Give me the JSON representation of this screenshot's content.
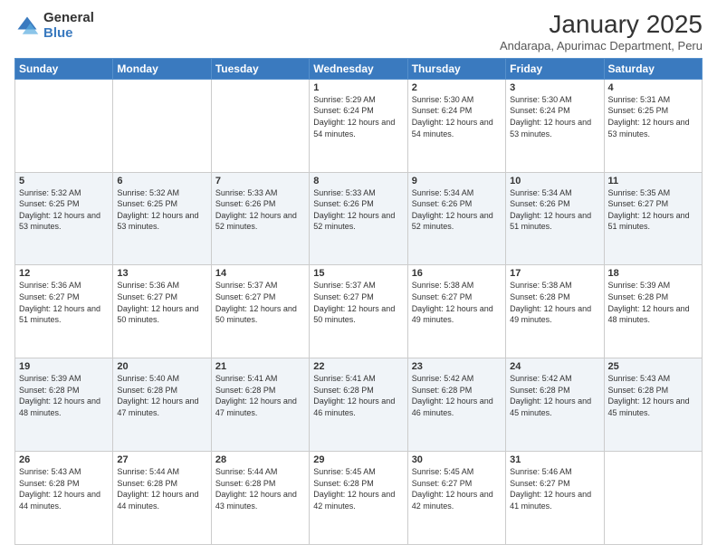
{
  "logo": {
    "general": "General",
    "blue": "Blue"
  },
  "header": {
    "title": "January 2025",
    "subtitle": "Andarapa, Apurimac Department, Peru"
  },
  "days_of_week": [
    "Sunday",
    "Monday",
    "Tuesday",
    "Wednesday",
    "Thursday",
    "Friday",
    "Saturday"
  ],
  "weeks": [
    [
      {
        "day": "",
        "info": ""
      },
      {
        "day": "",
        "info": ""
      },
      {
        "day": "",
        "info": ""
      },
      {
        "day": "1",
        "info": "Sunrise: 5:29 AM\nSunset: 6:24 PM\nDaylight: 12 hours and 54 minutes."
      },
      {
        "day": "2",
        "info": "Sunrise: 5:30 AM\nSunset: 6:24 PM\nDaylight: 12 hours and 54 minutes."
      },
      {
        "day": "3",
        "info": "Sunrise: 5:30 AM\nSunset: 6:24 PM\nDaylight: 12 hours and 53 minutes."
      },
      {
        "day": "4",
        "info": "Sunrise: 5:31 AM\nSunset: 6:25 PM\nDaylight: 12 hours and 53 minutes."
      }
    ],
    [
      {
        "day": "5",
        "info": "Sunrise: 5:32 AM\nSunset: 6:25 PM\nDaylight: 12 hours and 53 minutes."
      },
      {
        "day": "6",
        "info": "Sunrise: 5:32 AM\nSunset: 6:25 PM\nDaylight: 12 hours and 53 minutes."
      },
      {
        "day": "7",
        "info": "Sunrise: 5:33 AM\nSunset: 6:26 PM\nDaylight: 12 hours and 52 minutes."
      },
      {
        "day": "8",
        "info": "Sunrise: 5:33 AM\nSunset: 6:26 PM\nDaylight: 12 hours and 52 minutes."
      },
      {
        "day": "9",
        "info": "Sunrise: 5:34 AM\nSunset: 6:26 PM\nDaylight: 12 hours and 52 minutes."
      },
      {
        "day": "10",
        "info": "Sunrise: 5:34 AM\nSunset: 6:26 PM\nDaylight: 12 hours and 51 minutes."
      },
      {
        "day": "11",
        "info": "Sunrise: 5:35 AM\nSunset: 6:27 PM\nDaylight: 12 hours and 51 minutes."
      }
    ],
    [
      {
        "day": "12",
        "info": "Sunrise: 5:36 AM\nSunset: 6:27 PM\nDaylight: 12 hours and 51 minutes."
      },
      {
        "day": "13",
        "info": "Sunrise: 5:36 AM\nSunset: 6:27 PM\nDaylight: 12 hours and 50 minutes."
      },
      {
        "day": "14",
        "info": "Sunrise: 5:37 AM\nSunset: 6:27 PM\nDaylight: 12 hours and 50 minutes."
      },
      {
        "day": "15",
        "info": "Sunrise: 5:37 AM\nSunset: 6:27 PM\nDaylight: 12 hours and 50 minutes."
      },
      {
        "day": "16",
        "info": "Sunrise: 5:38 AM\nSunset: 6:27 PM\nDaylight: 12 hours and 49 minutes."
      },
      {
        "day": "17",
        "info": "Sunrise: 5:38 AM\nSunset: 6:28 PM\nDaylight: 12 hours and 49 minutes."
      },
      {
        "day": "18",
        "info": "Sunrise: 5:39 AM\nSunset: 6:28 PM\nDaylight: 12 hours and 48 minutes."
      }
    ],
    [
      {
        "day": "19",
        "info": "Sunrise: 5:39 AM\nSunset: 6:28 PM\nDaylight: 12 hours and 48 minutes."
      },
      {
        "day": "20",
        "info": "Sunrise: 5:40 AM\nSunset: 6:28 PM\nDaylight: 12 hours and 47 minutes."
      },
      {
        "day": "21",
        "info": "Sunrise: 5:41 AM\nSunset: 6:28 PM\nDaylight: 12 hours and 47 minutes."
      },
      {
        "day": "22",
        "info": "Sunrise: 5:41 AM\nSunset: 6:28 PM\nDaylight: 12 hours and 46 minutes."
      },
      {
        "day": "23",
        "info": "Sunrise: 5:42 AM\nSunset: 6:28 PM\nDaylight: 12 hours and 46 minutes."
      },
      {
        "day": "24",
        "info": "Sunrise: 5:42 AM\nSunset: 6:28 PM\nDaylight: 12 hours and 45 minutes."
      },
      {
        "day": "25",
        "info": "Sunrise: 5:43 AM\nSunset: 6:28 PM\nDaylight: 12 hours and 45 minutes."
      }
    ],
    [
      {
        "day": "26",
        "info": "Sunrise: 5:43 AM\nSunset: 6:28 PM\nDaylight: 12 hours and 44 minutes."
      },
      {
        "day": "27",
        "info": "Sunrise: 5:44 AM\nSunset: 6:28 PM\nDaylight: 12 hours and 44 minutes."
      },
      {
        "day": "28",
        "info": "Sunrise: 5:44 AM\nSunset: 6:28 PM\nDaylight: 12 hours and 43 minutes."
      },
      {
        "day": "29",
        "info": "Sunrise: 5:45 AM\nSunset: 6:28 PM\nDaylight: 12 hours and 42 minutes."
      },
      {
        "day": "30",
        "info": "Sunrise: 5:45 AM\nSunset: 6:27 PM\nDaylight: 12 hours and 42 minutes."
      },
      {
        "day": "31",
        "info": "Sunrise: 5:46 AM\nSunset: 6:27 PM\nDaylight: 12 hours and 41 minutes."
      },
      {
        "day": "",
        "info": ""
      }
    ]
  ]
}
